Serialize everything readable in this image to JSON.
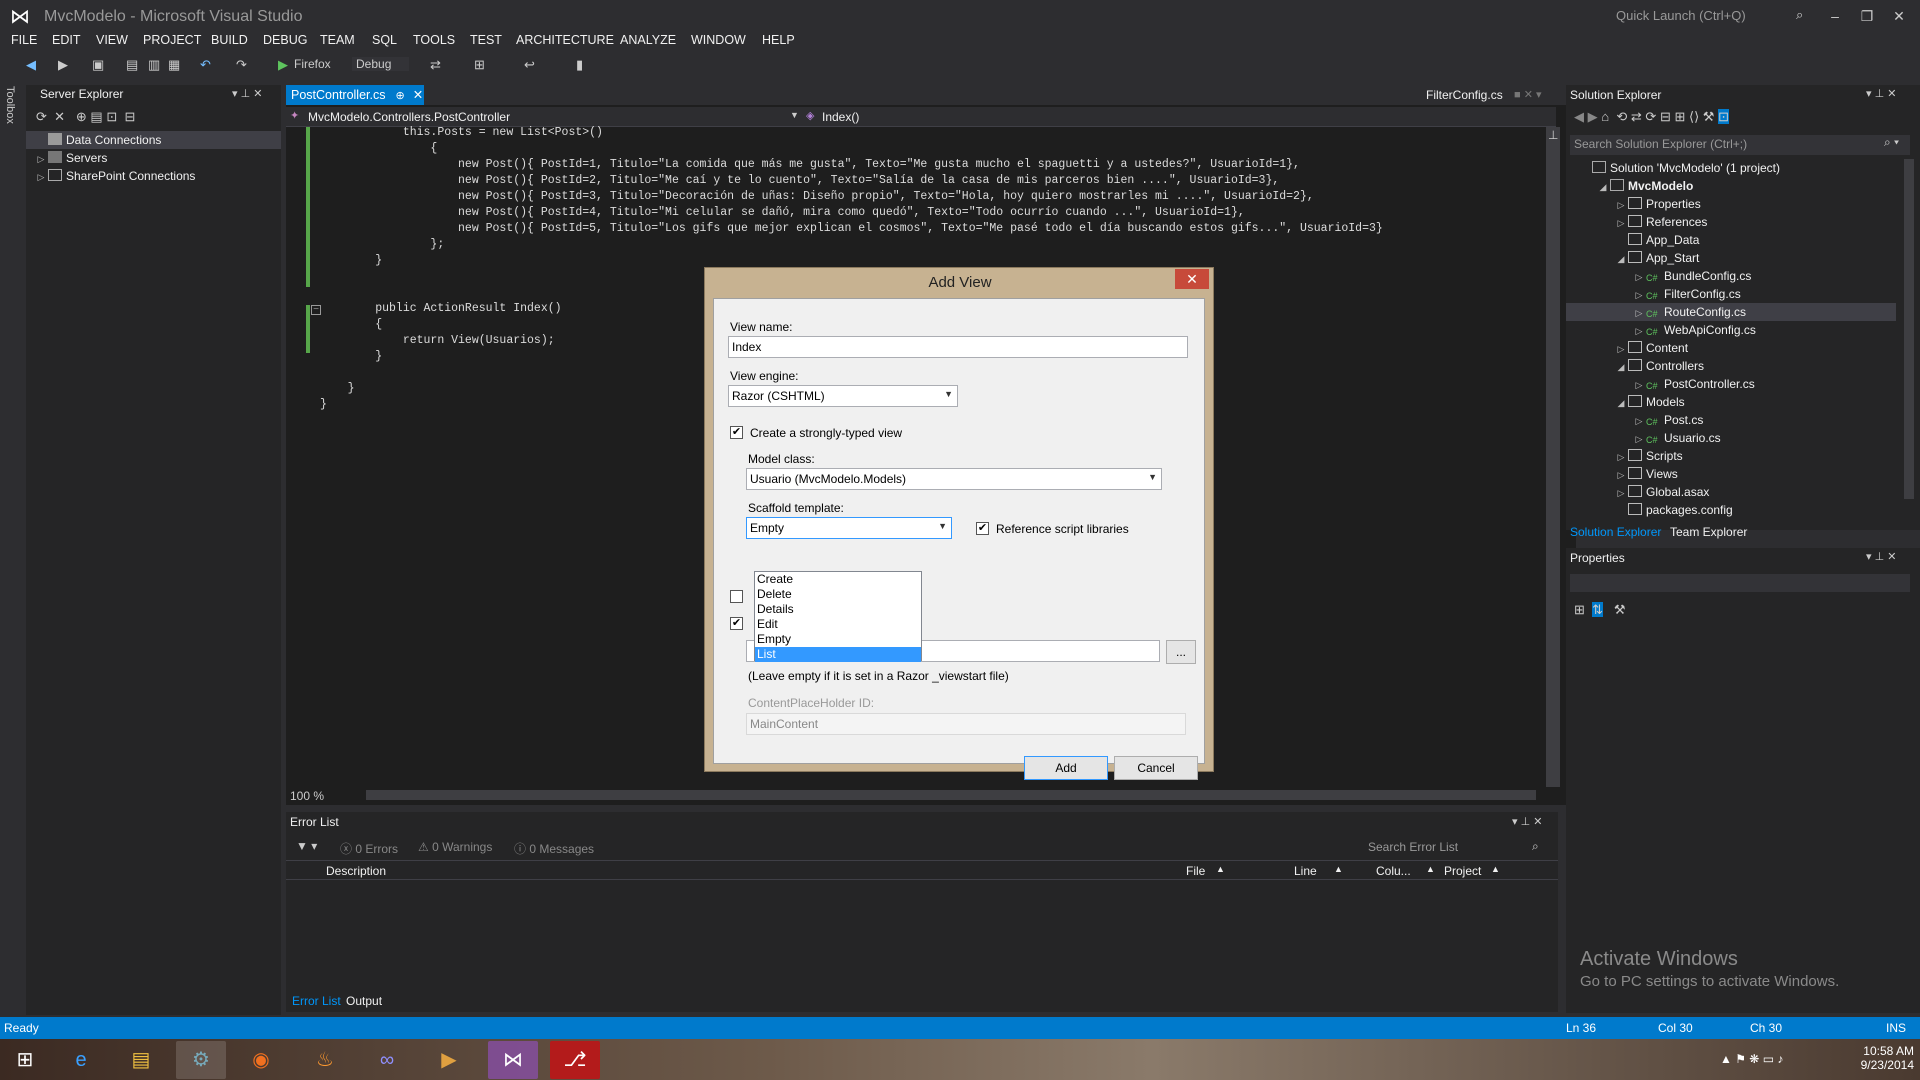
{
  "app": {
    "title": "MvcModelo - Microsoft Visual Studio",
    "quick_launch": "Quick Launch (Ctrl+Q)"
  },
  "menu": [
    "FILE",
    "EDIT",
    "VIEW",
    "PROJECT",
    "BUILD",
    "DEBUG",
    "TEAM",
    "SQL",
    "TOOLS",
    "TEST",
    "ARCHITECTURE",
    "ANALYZE",
    "WINDOW",
    "HELP"
  ],
  "toolbar": {
    "browser": "Firefox",
    "config": "Debug"
  },
  "toolbox_label": "Toolbox",
  "server_explorer": {
    "title": "Server Explorer",
    "items": [
      "Data Connections",
      "Servers",
      "SharePoint Connections"
    ]
  },
  "editor": {
    "active_tab": "PostController.cs",
    "right_tab": "FilterConfig.cs",
    "nav_left": "MvcModelo.Controllers.PostController",
    "nav_right": "Index()",
    "zoom": "100 %",
    "code": [
      "            this.Posts = new List<Post>()",
      "                {",
      "                    new Post(){ PostId=1, Titulo=\"La comida que más me gusta\", Texto=\"Me gusta mucho el spaguetti y a ustedes?\", UsuarioId=1},",
      "                    new Post(){ PostId=2, Titulo=\"Me caí y te lo cuento\", Texto=\"Salía de la casa de mis parceros bien ....\", UsuarioId=3},",
      "                    new Post(){ PostId=3, Titulo=\"Decoración de uñas: Diseño propio\", Texto=\"Hola, hoy quiero mostrarles mi ....\", UsuarioId=2},",
      "                    new Post(){ PostId=4, Titulo=\"Mi celular se dañó, mira como quedó\", Texto=\"Todo ocurrío cuando ...\", UsuarioId=1},",
      "                    new Post(){ PostId=5, Titulo=\"Los gifs que mejor explican el cosmos\", Texto=\"Me pasé todo el día buscando estos gifs...\", UsuarioId=3}",
      "                };",
      "        }",
      "",
      "",
      "        public ActionResult Index()",
      "        {",
      "            return View(Usuarios);",
      "        }",
      "",
      "    }",
      "}"
    ]
  },
  "dialog": {
    "title": "Add View",
    "view_name_label": "View name:",
    "view_name": "Index",
    "view_engine_label": "View engine:",
    "view_engine": "Razor (CSHTML)",
    "strongly_typed_label": "Create a strongly-typed view",
    "model_class_label": "Model class:",
    "model_class": "Usuario (MvcModelo.Models)",
    "scaffold_label": "Scaffold template:",
    "scaffold_value": "Empty",
    "ref_scripts_label": "Reference script libraries",
    "scaffold_options": [
      "Create",
      "Delete",
      "Details",
      "Edit",
      "Empty",
      "List"
    ],
    "highlighted_option": "List",
    "browse_label": "...",
    "layout_hint": "(Leave empty if it is set in a Razor _viewstart file)",
    "placeholder_label": "ContentPlaceHolder ID:",
    "placeholder_value": "MainContent",
    "add_label": "Add",
    "cancel_label": "Cancel"
  },
  "error_list": {
    "title": "Error List",
    "errors": "0 Errors",
    "warnings": "0 Warnings",
    "messages": "0 Messages",
    "search": "Search Error List",
    "columns": [
      "Description",
      "File",
      "Line",
      "Colu...",
      "Project"
    ],
    "tabs": [
      "Error List",
      "Output"
    ]
  },
  "solution_explorer": {
    "title": "Solution Explorer",
    "search": "Search Solution Explorer (Ctrl+;)",
    "items": [
      {
        "label": "Solution 'MvcModelo' (1 project)",
        "level": 0,
        "arrow": ""
      },
      {
        "label": "MvcModelo",
        "level": 1,
        "arrow": "◢",
        "bold": true
      },
      {
        "label": "Properties",
        "level": 2,
        "arrow": "▷"
      },
      {
        "label": "References",
        "level": 2,
        "arrow": "▷"
      },
      {
        "label": "App_Data",
        "level": 2,
        "arrow": ""
      },
      {
        "label": "App_Start",
        "level": 2,
        "arrow": "◢"
      },
      {
        "label": "BundleConfig.cs",
        "level": 3,
        "arrow": "▷"
      },
      {
        "label": "FilterConfig.cs",
        "level": 3,
        "arrow": "▷"
      },
      {
        "label": "RouteConfig.cs",
        "level": 3,
        "arrow": "▷",
        "selected": true
      },
      {
        "label": "WebApiConfig.cs",
        "level": 3,
        "arrow": "▷"
      },
      {
        "label": "Content",
        "level": 2,
        "arrow": "▷"
      },
      {
        "label": "Controllers",
        "level": 2,
        "arrow": "◢"
      },
      {
        "label": "PostController.cs",
        "level": 3,
        "arrow": "▷"
      },
      {
        "label": "Models",
        "level": 2,
        "arrow": "◢"
      },
      {
        "label": "Post.cs",
        "level": 3,
        "arrow": "▷"
      },
      {
        "label": "Usuario.cs",
        "level": 3,
        "arrow": "▷"
      },
      {
        "label": "Scripts",
        "level": 2,
        "arrow": "▷"
      },
      {
        "label": "Views",
        "level": 2,
        "arrow": "▷"
      },
      {
        "label": "Global.asax",
        "level": 2,
        "arrow": "▷"
      },
      {
        "label": "packages.config",
        "level": 2,
        "arrow": ""
      }
    ],
    "tabs": [
      "Solution Explorer",
      "Team Explorer"
    ]
  },
  "properties": {
    "title": "Properties"
  },
  "watermark": {
    "line1": "Activate Windows",
    "line2": "Go to PC settings to activate Windows."
  },
  "status": {
    "left": "Ready",
    "ln": "Ln 36",
    "col": "Col 30",
    "ch": "Ch 30",
    "ins": "INS"
  },
  "clock": {
    "time": "10:58 AM",
    "date": "9/23/2014"
  },
  "colors": {
    "accent": "#007acc",
    "editor_bg": "#1e1e1e",
    "panel_bg": "#252526",
    "chrome_bg": "#2d2d30"
  }
}
